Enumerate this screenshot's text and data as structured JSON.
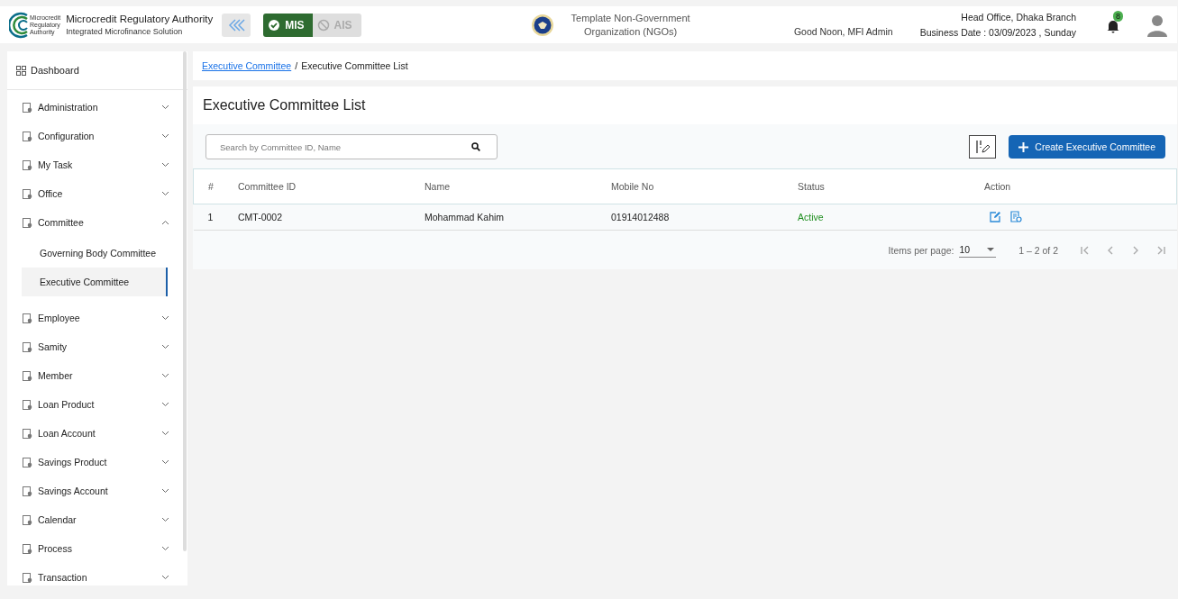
{
  "header": {
    "logo_text": [
      "Microcredit",
      "Regulatory",
      "Authority"
    ],
    "title": "Microcredit Regulatory Authority",
    "subtitle": "Integrated Microfinance Solution",
    "modes": [
      {
        "label": "MIS",
        "selected": true
      },
      {
        "label": "AIS",
        "selected": false
      }
    ],
    "org_name": "Template Non-Government Organization (NGOs)",
    "greeting": "Good Noon, MFI Admin",
    "branch": "Head Office, Dhaka Branch",
    "business_date": "Business Date : 03/09/2023 , Sunday",
    "notification_count": "8"
  },
  "sidebar": {
    "dashboard": "Dashboard",
    "items": [
      {
        "label": "Administration",
        "expanded": false
      },
      {
        "label": "Configuration",
        "expanded": false
      },
      {
        "label": "My Task",
        "expanded": false
      },
      {
        "label": "Office",
        "expanded": false
      },
      {
        "label": "Committee",
        "expanded": true,
        "children": [
          {
            "label": "Governing Body Committee",
            "selected": false
          },
          {
            "label": "Executive Committee",
            "selected": true
          }
        ]
      },
      {
        "label": "Employee",
        "expanded": false
      },
      {
        "label": "Samity",
        "expanded": false
      },
      {
        "label": "Member",
        "expanded": false
      },
      {
        "label": "Loan Product",
        "expanded": false
      },
      {
        "label": "Loan Account",
        "expanded": false
      },
      {
        "label": "Savings Product",
        "expanded": false
      },
      {
        "label": "Savings Account",
        "expanded": false
      },
      {
        "label": "Calendar",
        "expanded": false
      },
      {
        "label": "Process",
        "expanded": false
      },
      {
        "label": "Transaction",
        "expanded": false
      }
    ]
  },
  "breadcrumb": {
    "link": "Executive Committee",
    "separator": "/",
    "current": "Executive Committee List"
  },
  "page_title": "Executive Committee List",
  "search": {
    "placeholder": "Search by Committee ID, Name"
  },
  "create_button": "Create Executive Committee",
  "table": {
    "columns": [
      "#",
      "Committee ID",
      "Name",
      "Mobile No",
      "Status",
      "Action"
    ],
    "rows": [
      {
        "index": "1",
        "committee_id": "CMT-0002",
        "name": "Mohammad Kahim",
        "mobile": "01914012488",
        "status": "Active"
      }
    ]
  },
  "paginator": {
    "label": "Items per page:",
    "page_size": "10",
    "range": "1 – 2 of 2"
  }
}
